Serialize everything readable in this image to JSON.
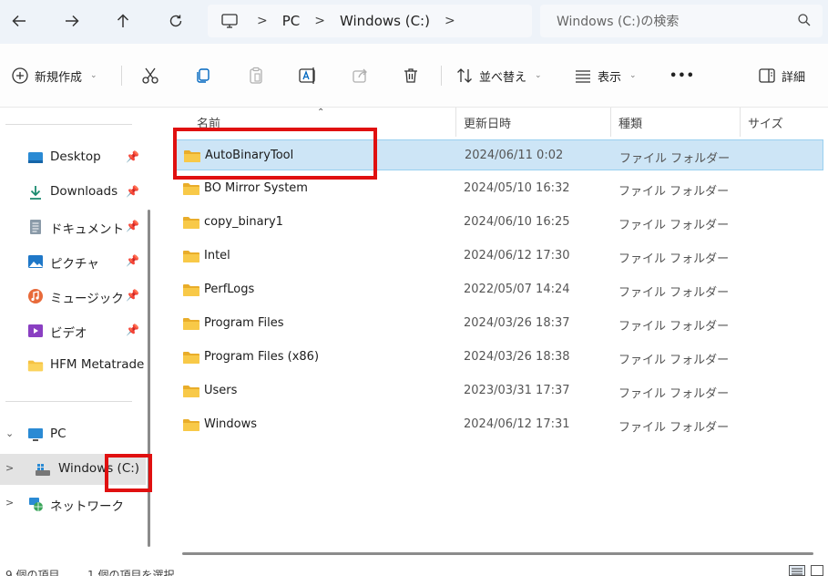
{
  "address": {
    "crumbs": [
      "PC",
      "Windows (C:)"
    ],
    "search_placeholder": "Windows (C:)の検索"
  },
  "toolbar": {
    "new_label": "新規作成",
    "sort_label": "並べ替え",
    "view_label": "表示",
    "more_label": "•••",
    "details_label": "詳細"
  },
  "sidebar": {
    "quick": [
      {
        "label": "Desktop",
        "icon": "desktop-icon"
      },
      {
        "label": "Downloads",
        "icon": "download-icon"
      },
      {
        "label": "ドキュメント",
        "icon": "document-icon"
      },
      {
        "label": "ピクチャ",
        "icon": "pictures-icon"
      },
      {
        "label": "ミュージック",
        "icon": "music-icon"
      },
      {
        "label": "ビデオ",
        "icon": "video-icon"
      },
      {
        "label": "HFM Metatrade",
        "icon": "folder-icon"
      }
    ],
    "pc_label": "PC",
    "drive_label": "Windows (C:)",
    "network_label": "ネットワーク"
  },
  "columns": {
    "name": "名前",
    "date": "更新日時",
    "type": "種類",
    "size": "サイズ"
  },
  "files": [
    {
      "name": "AutoBinaryTool",
      "date": "2024/06/11 0:02",
      "type": "ファイル フォルダー",
      "selected": true
    },
    {
      "name": "BO Mirror System",
      "date": "2024/05/10 16:32",
      "type": "ファイル フォルダー"
    },
    {
      "name": "copy_binary1",
      "date": "2024/06/10 16:25",
      "type": "ファイル フォルダー"
    },
    {
      "name": "Intel",
      "date": "2024/06/12 17:30",
      "type": "ファイル フォルダー"
    },
    {
      "name": "PerfLogs",
      "date": "2022/05/07 14:24",
      "type": "ファイル フォルダー"
    },
    {
      "name": "Program Files",
      "date": "2024/03/26 18:37",
      "type": "ファイル フォルダー"
    },
    {
      "name": "Program Files (x86)",
      "date": "2024/03/26 18:38",
      "type": "ファイル フォルダー"
    },
    {
      "name": "Users",
      "date": "2023/03/31 17:37",
      "type": "ファイル フォルダー"
    },
    {
      "name": "Windows",
      "date": "2024/06/12 17:31",
      "type": "ファイル フォルダー"
    }
  ],
  "status": {
    "count": "9 個の項目",
    "selected": "1 個の項目を選択"
  },
  "colors": {
    "accent": "#0067c0",
    "selection": "#cde5f6",
    "folder": "#f5c242",
    "annotation": "#e01010"
  }
}
